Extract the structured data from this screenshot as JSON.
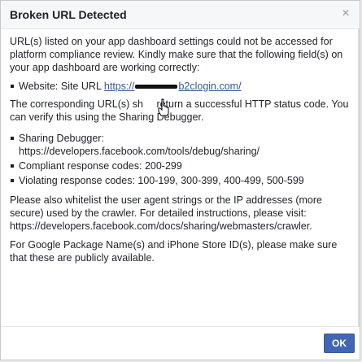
{
  "dialog": {
    "title": "Broken URL Detected",
    "close_glyph": "×",
    "intro": "URL(s) listed on your app dashboard settings could not be accessed for platform compliance review. Kindly make sure that the following field(s) on your app dashboard are working correctly:",
    "fields": [
      {
        "label": "Website: Site URL ",
        "url_prefix": "https://",
        "url_suffix": "b2clogin.com/"
      }
    ],
    "http_status_before": "The corresponding URL(s) sh",
    "http_status_after": " return a successful HTTP status code. You can verify this using the Sharing Debugger.",
    "debugger_items": [
      {
        "text": "Sharing Debugger:"
      },
      {
        "text": "Compliant response codes: 200-299"
      },
      {
        "text": "Violating response codes: 100-199, 300-399, 400-499, 500-599"
      }
    ],
    "debugger_url": "https://developers.facebook.com/tools/debug/sharing/",
    "whitelist_text": "Please also whitelist the user agent strings or the IP addresses (more secure) used by the crawler. For detailed instructions, please visit:",
    "webmasters_url": "https://developers.facebook.com/docs/sharing/webmasters/crawler.",
    "package_text": "For Google Package Name(s) and iPhone Store ID(s), please make sure that these are publicly available.",
    "ok_label": "OK"
  },
  "colors": {
    "link": "#365899",
    "ok_button": "#4267b2",
    "header_bg": "#f6f7f9"
  }
}
